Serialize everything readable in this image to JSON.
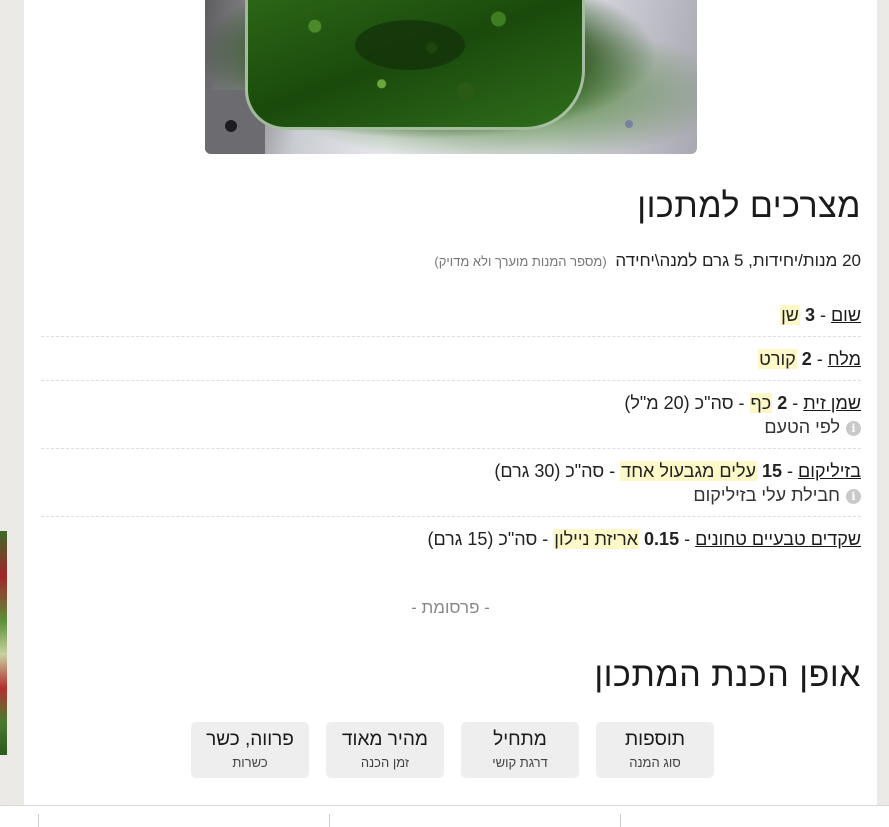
{
  "ingredients_section": {
    "title": "מצרכים למתכון",
    "servings_text": "20 מנות/יחידות, 5 גרם למנה\\יחידה",
    "servings_note": "(מספר המנות מוערך ולא מדויק)",
    "items": [
      {
        "name": "שום",
        "qty": "3",
        "unit": "שן",
        "total": "",
        "note": ""
      },
      {
        "name": "מלח",
        "qty": "2",
        "unit": "קורט",
        "total": "",
        "note": ""
      },
      {
        "name": "שמן זית",
        "qty": "2",
        "unit": "כף",
        "total": "סה\"כ (20 מ\"ל)",
        "note": "לפי הטעם"
      },
      {
        "name": "בזיליקום",
        "qty": "15",
        "unit": "עלים מגבעול אחד",
        "total": "סה\"כ (30 גרם)",
        "note": "חבילת עלי בזיליקום"
      },
      {
        "name": "שקדים טבעיים טחונים",
        "qty": "0.15",
        "unit": "אריזת ניילון",
        "total": "סה\"כ (15 גרם)",
        "note": ""
      }
    ]
  },
  "ad_label": "- פרסומת -",
  "prep_section": {
    "title": "אופן הכנת המתכון",
    "tags": [
      {
        "value": "תוספות",
        "label": "סוג המנה"
      },
      {
        "value": "מתחיל",
        "label": "דרגת קושי"
      },
      {
        "value": "מהיר מאוד",
        "label": "זמן הכנה"
      },
      {
        "value": "פרווה, כשר",
        "label": "כשרות"
      }
    ]
  },
  "icons": {
    "info": "info-icon"
  }
}
